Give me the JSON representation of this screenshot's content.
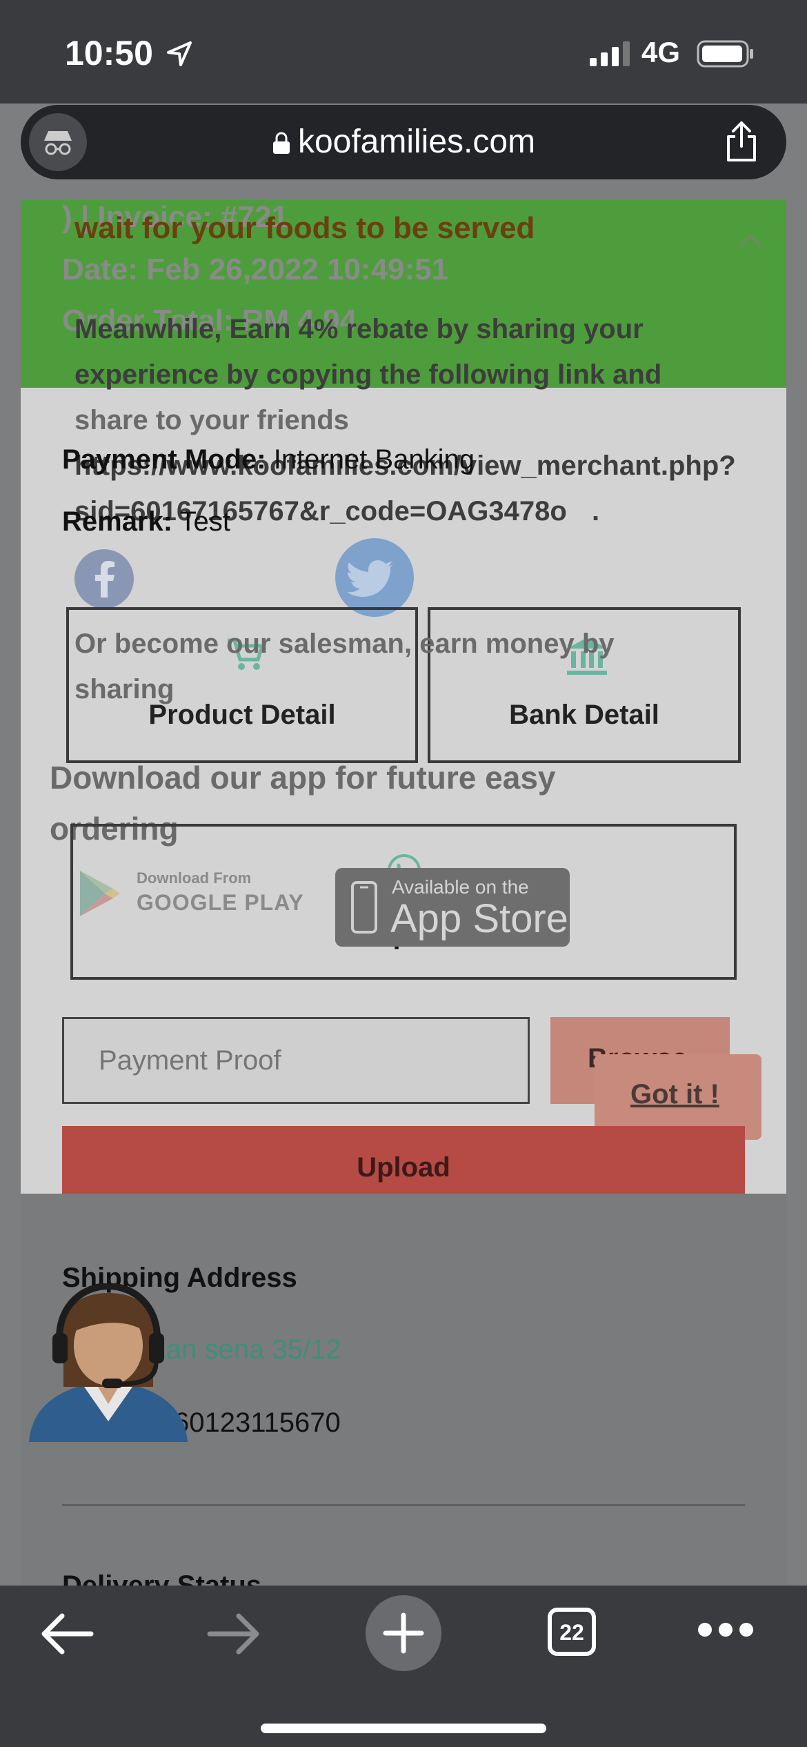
{
  "status_bar": {
    "time": "10:50",
    "network": "4G"
  },
  "browser": {
    "domain": "koofamilies.com",
    "tab_count": "22"
  },
  "header": {
    "message": "wait for your foods to be served",
    "ghost_invoice": ") | Invoice: #721",
    "ghost_date": "Date: Feb 26,2022 10:49:51",
    "ghost_total": "Order Total: RM 4.94"
  },
  "share": {
    "line1": "Meanwhile, Earn 4% rebate by sharing your",
    "line2": "experience by copying the following link and",
    "line3": "share to your friends",
    "link_line1": "https://www.koofamilies.com/view_merchant.php?",
    "link_line2": "sid=60167165767&r_code=OAG3478o",
    "link_period": ".",
    "salesman_line1": "Or become our salesman, earn money by",
    "salesman_line2": "sharing"
  },
  "order": {
    "payment_mode_label": "Payment Mode:",
    "payment_mode_value": "Internet Banking",
    "remark_label": "Remark:",
    "remark_value": "Test"
  },
  "buttons": {
    "product_detail": "Product Detail",
    "bank_detail": "Bank Detail",
    "helpline": "Helpline",
    "browse": "Browse",
    "got_it": "Got it !",
    "upload": "Upload"
  },
  "download": {
    "line1": "Download our app for future easy",
    "line2": "ordering",
    "google_small": "Download From",
    "google_big": "GOOGLE PLAY",
    "apple_small": "Available on the",
    "apple_big": "App Store"
  },
  "payment_proof": {
    "placeholder": "Payment Proof"
  },
  "shipping": {
    "title": "Shipping Address",
    "address": "lan sena 35/12",
    "phone": "60123115670"
  },
  "delivery": {
    "title": "Delivery Status"
  },
  "colors": {
    "green_header": "#4e9d3c",
    "link": "#6ab5a0",
    "upload": "#b64a44",
    "browse": "#c4877a"
  }
}
